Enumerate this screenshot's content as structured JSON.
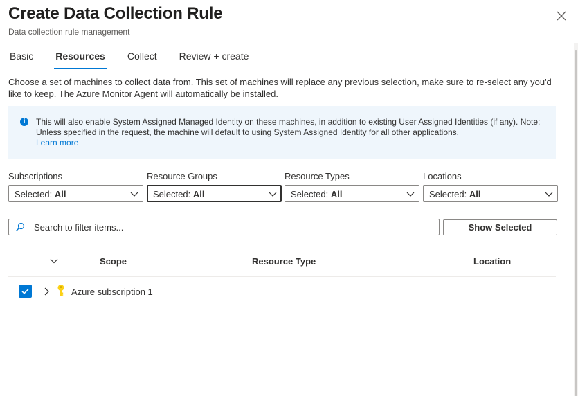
{
  "header": {
    "title": "Create Data Collection Rule",
    "subtitle": "Data collection rule management"
  },
  "tabs": [
    {
      "label": "Basic",
      "active": false
    },
    {
      "label": "Resources",
      "active": true
    },
    {
      "label": "Collect",
      "active": false
    },
    {
      "label": "Review + create",
      "active": false
    }
  ],
  "description": "Choose a set of machines to collect data from. This set of machines will replace any previous selection, make sure to re-select any you'd like to keep. The Azure Monitor Agent will automatically be installed.",
  "info": {
    "text": "This will also enable System Assigned Managed Identity on these machines, in addition to existing User Assigned Identities (if any). Note: Unless specified in the request, the machine will default to using System Assigned Identity for all other applications.",
    "link": "Learn more",
    "icon": "info-icon"
  },
  "filters": [
    {
      "label": "Subscriptions",
      "prefix": "Selected: ",
      "value": "All"
    },
    {
      "label": "Resource Groups",
      "prefix": "Selected: ",
      "value": "All"
    },
    {
      "label": "Resource Types",
      "prefix": "Selected: ",
      "value": "All"
    },
    {
      "label": "Locations",
      "prefix": "Selected: ",
      "value": "All"
    }
  ],
  "search": {
    "placeholder": "Search to filter items..."
  },
  "show_selected_label": "Show Selected",
  "table": {
    "columns": [
      "Scope",
      "Resource Type",
      "Location"
    ],
    "rows": [
      {
        "scope": "Azure subscription 1",
        "resource_type": "",
        "location": "",
        "checked": true,
        "icon": "key-icon"
      }
    ]
  },
  "colors": {
    "accent": "#0078d4",
    "info_background": "#eff6fc",
    "key_icon": "#fcd116"
  }
}
